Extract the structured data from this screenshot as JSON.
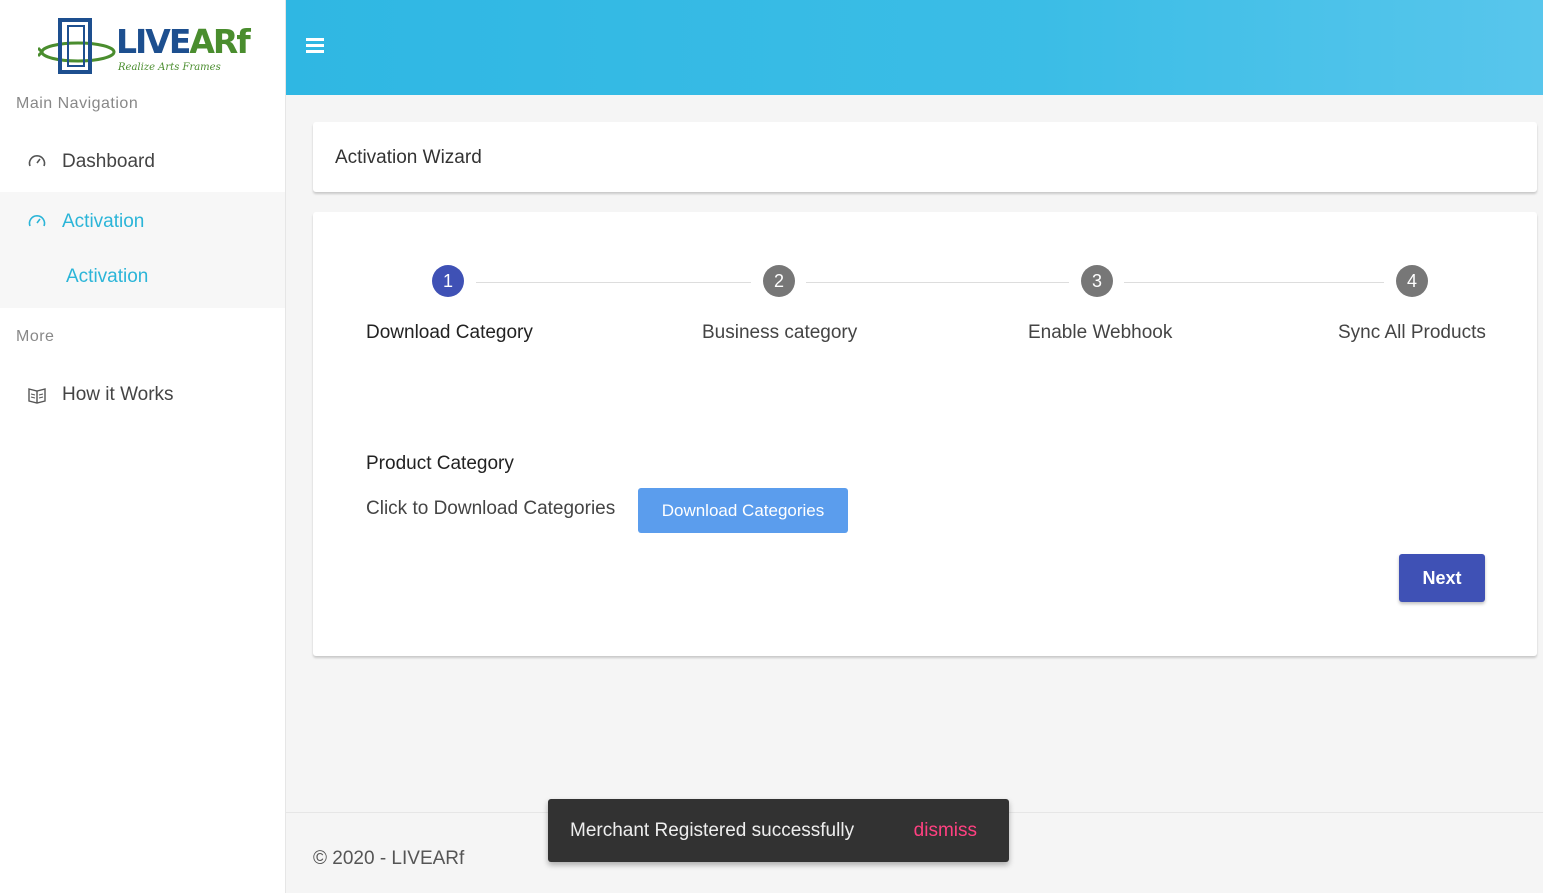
{
  "brand": {
    "name_main": "LIVE",
    "name_accent": "ARf",
    "tagline": "Realize Arts Frames"
  },
  "sidebar": {
    "section_main": "Main Navigation",
    "section_more": "More",
    "items": [
      {
        "label": "Dashboard",
        "icon": "dashboard-gauge-icon"
      },
      {
        "label": "Activation",
        "icon": "dashboard-gauge-icon",
        "active": true
      },
      {
        "label": "How it Works",
        "icon": "book-icon"
      }
    ],
    "sub_item": "Activation"
  },
  "header": {
    "menu_icon": "hamburger-menu-icon"
  },
  "page": {
    "title": "Activation Wizard"
  },
  "wizard": {
    "steps": [
      {
        "number": "1",
        "label": "Download Category",
        "state": "current"
      },
      {
        "number": "2",
        "label": "Business category",
        "state": "todo"
      },
      {
        "number": "3",
        "label": "Enable Webhook",
        "state": "todo"
      },
      {
        "number": "4",
        "label": "Sync All Products",
        "state": "todo"
      }
    ],
    "section_title": "Product Category",
    "download_text": "Click to Download Categories",
    "download_button": "Download Categories",
    "next_button": "Next"
  },
  "footer": {
    "copyright": "© 2020 - LIVEARf"
  },
  "snackbar": {
    "message": "Merchant Registered successfully",
    "action": "dismiss"
  },
  "colors": {
    "accent": "#2bb5d8",
    "primary": "#3f51b5",
    "download": "#5b9ded",
    "snackbar_action": "#ff4081"
  }
}
